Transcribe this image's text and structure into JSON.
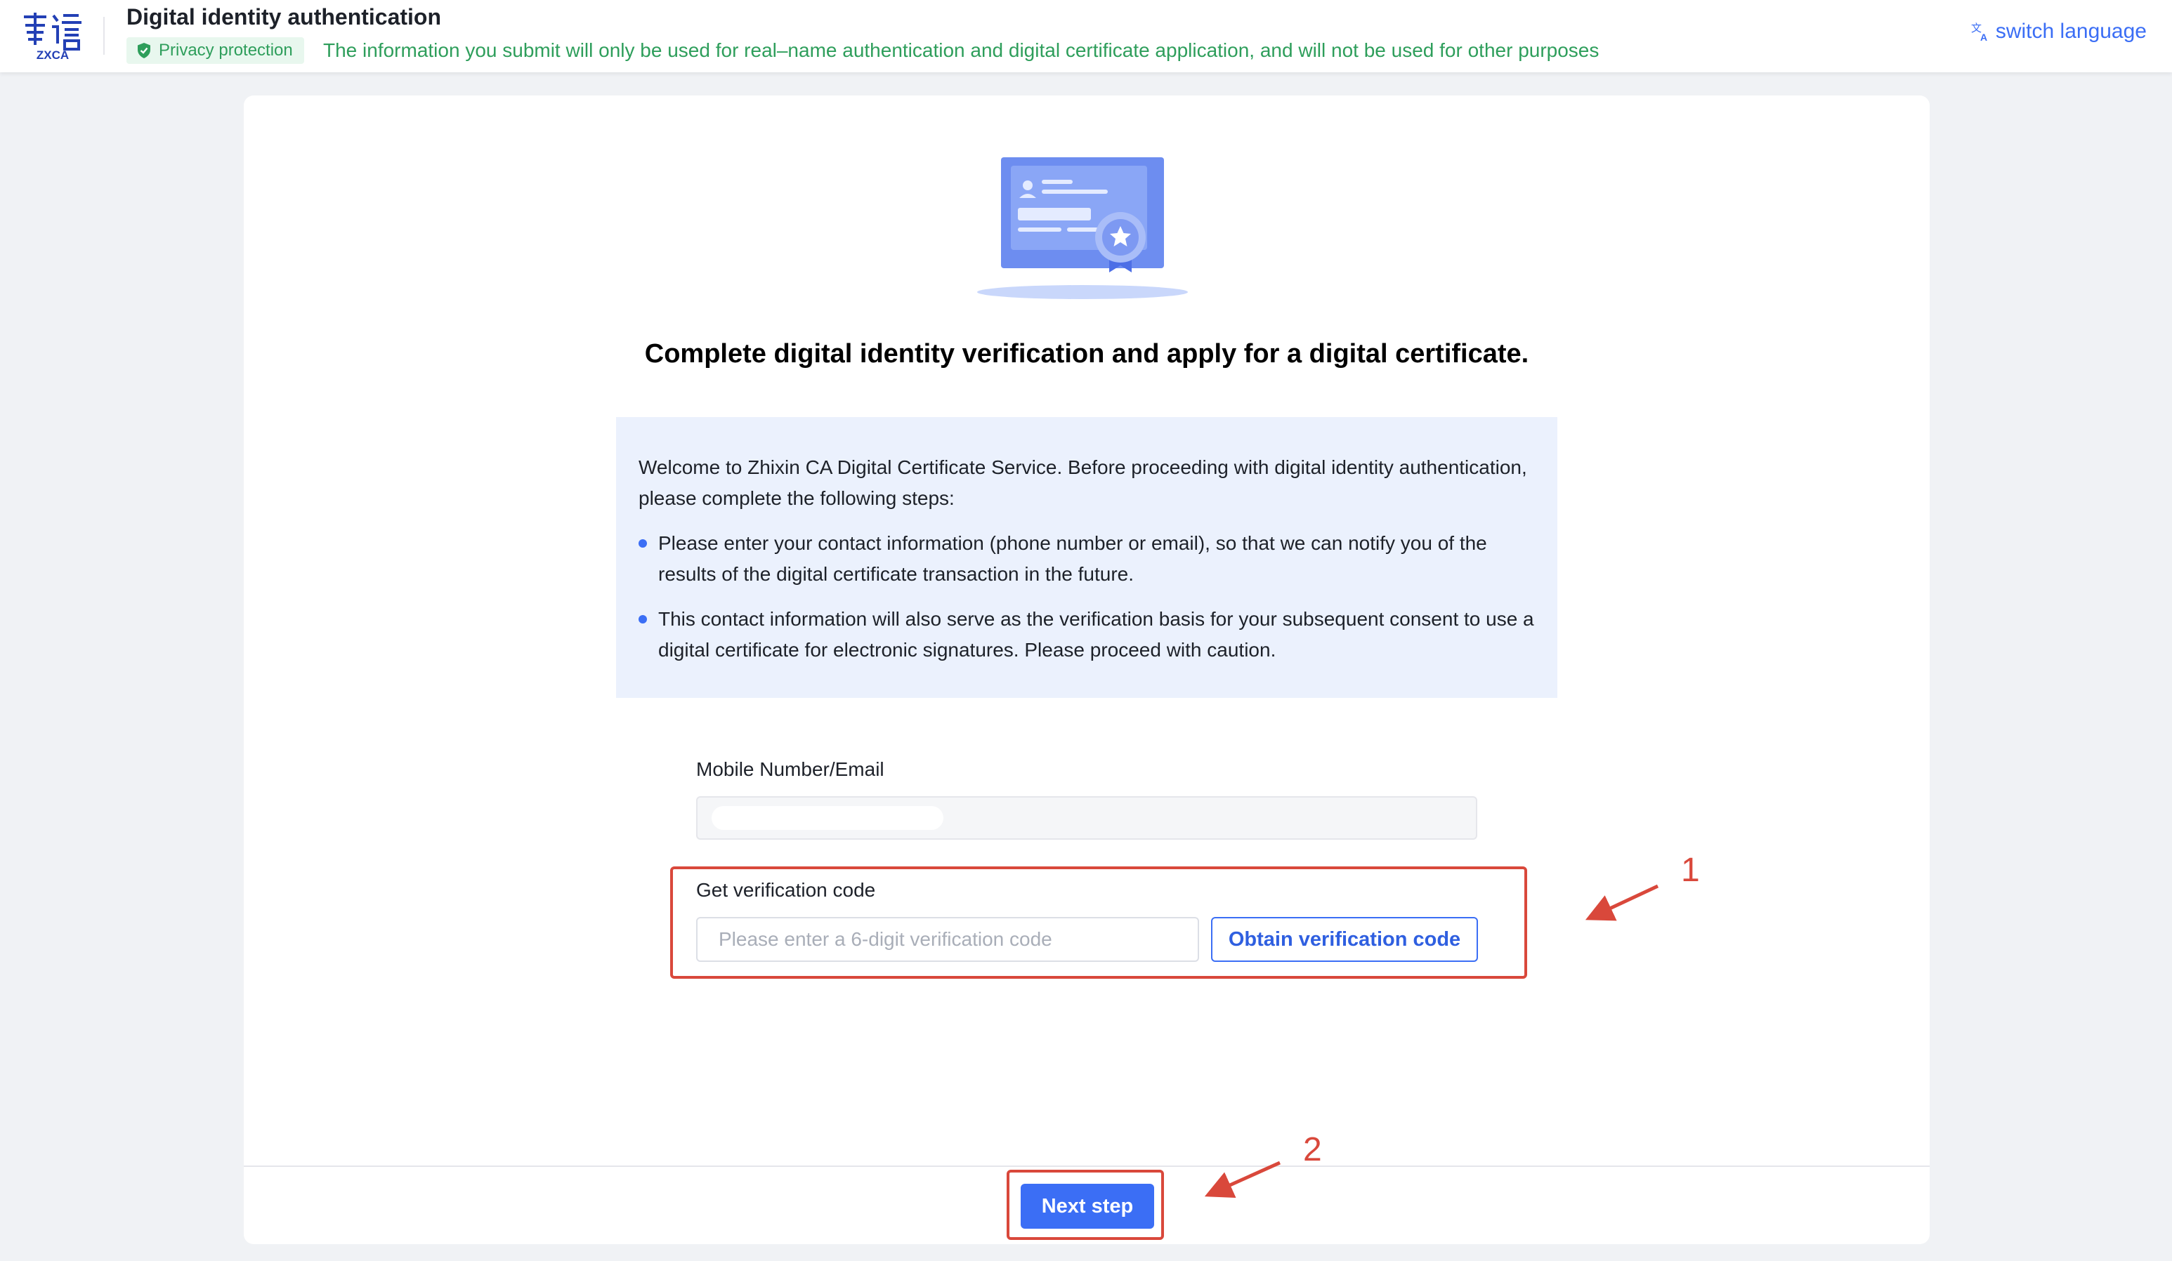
{
  "header": {
    "logo_text": "ZXCA",
    "title": "Digital identity authentication",
    "privacy_badge": "Privacy protection",
    "privacy_note": "The information you submit will only be used for real–name authentication and digital certificate application, and will not be used for other purposes",
    "switch_language": "switch language"
  },
  "main": {
    "heading": "Complete digital identity verification and apply for a digital certificate.",
    "info": {
      "intro": "Welcome to Zhixin CA Digital Certificate Service. Before proceeding with digital identity authentication, please complete the following steps:",
      "items": [
        "Please enter your contact information (phone number or email), so that we can notify you of the results of the digital certificate transaction in the future.",
        "This contact information will also serve as the verification basis for your subsequent consent to use a digital certificate for electronic signatures. Please proceed with caution."
      ]
    },
    "contact_label": "Mobile Number/Email",
    "code_label": "Get verification code",
    "code_placeholder": "Please enter a 6-digit verification code",
    "obtain_button": "Obtain verification code",
    "next_button": "Next step"
  },
  "annotations": {
    "step1": "1",
    "step2": "2"
  },
  "colors": {
    "primary": "#3b6ef5",
    "success": "#2e9e5b",
    "annotation": "#d9483b",
    "info_bg": "#ebf1fd"
  },
  "icons": [
    "zxca-logo",
    "shield-check-icon",
    "translate-icon",
    "certificate-illustration"
  ]
}
